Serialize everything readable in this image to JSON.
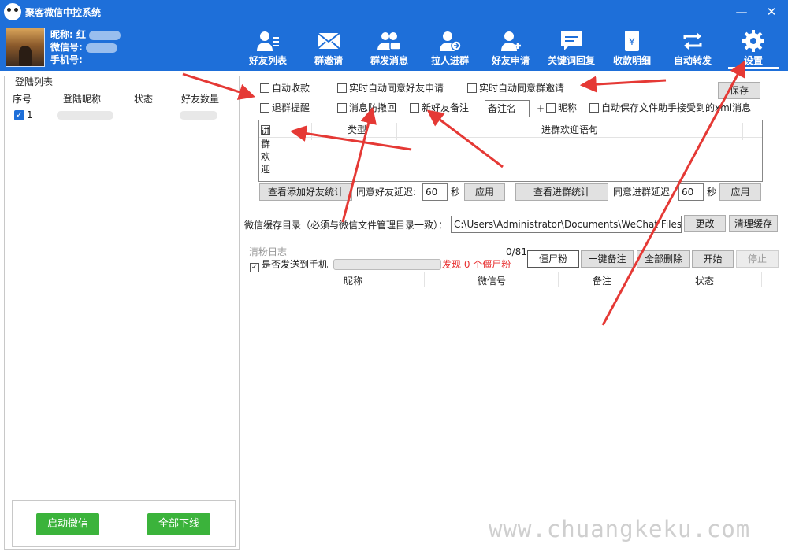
{
  "window": {
    "title": "聚客微信中控系统",
    "minimize": "—",
    "close": "✕"
  },
  "user": {
    "nickname_label": "昵称:",
    "nickname_value": "红",
    "wechat_label": "微信号:",
    "wechat_value": "",
    "phone_label": "手机号:",
    "phone_value": ""
  },
  "nav": [
    {
      "label": "好友列表",
      "icon": "friends-list-icon"
    },
    {
      "label": "群邀请",
      "icon": "mail-icon"
    },
    {
      "label": "群发消息",
      "icon": "group-message-icon"
    },
    {
      "label": "拉人进群",
      "icon": "pull-user-icon"
    },
    {
      "label": "好友申请",
      "icon": "add-friend-icon"
    },
    {
      "label": "关键词回复",
      "icon": "keyword-reply-icon"
    },
    {
      "label": "收款明细",
      "icon": "payment-icon"
    },
    {
      "label": "自动转发",
      "icon": "repeat-icon"
    },
    {
      "label": "设置",
      "icon": "gear-icon"
    }
  ],
  "active_nav": "设置",
  "login_list": {
    "legend": "登陆列表",
    "columns": [
      "序号",
      "登陆昵称",
      "状态",
      "好友数量"
    ],
    "rows": [
      {
        "index": "1",
        "checked": true
      }
    ],
    "start_button": "启动微信",
    "logout_button": "全部下线"
  },
  "settings": {
    "auto_collect": "自动收款",
    "auto_accept_friend": "实时自动同意好友申请",
    "auto_accept_group": "实时自动同意群邀请",
    "save_button": "保存",
    "quit_group_remind": "退群提醒",
    "anti_recall": "消息防撤回",
    "new_friend_remark": "新好友备注",
    "remark_name_value": "备注名",
    "plus": "+",
    "nickname_option": "昵称",
    "auto_save_xml": "自动保存文件助手接受到的xml消息",
    "welcome_checkbox": "进群欢迎",
    "welcome_type_col": "类型",
    "welcome_msg_col": "进群欢迎语句",
    "view_friend_stats": "查看添加好友统计",
    "friend_delay_label": "同意好友延迟:",
    "friend_delay_value": "60",
    "seconds": "秒",
    "apply": "应用",
    "view_group_stats": "查看进群统计",
    "group_delay_label": "同意进群延迟",
    "group_delay_value": "60",
    "cache_dir_label": "微信缓存目录（必须与微信文件管理目录一致）：",
    "cache_dir_value": "C:\\Users\\Administrator\\Documents\\WeChat Files\\",
    "change_button": "更改",
    "clear_cache_button": "清理缓存"
  },
  "clean_log": {
    "title": "清粉日志",
    "counter": "0/81",
    "send_to_phone": "是否发送到手机",
    "progress": 0,
    "found_text": "发现 0 个僵尸粉",
    "zombie_button": "僵尸粉",
    "remark_all_button": "一键备注",
    "delete_all_button": "全部删除",
    "start_button": "开始",
    "stop_button": "停止",
    "columns": [
      "昵称",
      "微信号",
      "备注",
      "状态"
    ]
  },
  "watermark": "www.chuangkeku.com",
  "colors": {
    "primary": "#1e6fd9",
    "green": "#3bb33b",
    "red": "#e83030",
    "arrow": "#e53935"
  }
}
